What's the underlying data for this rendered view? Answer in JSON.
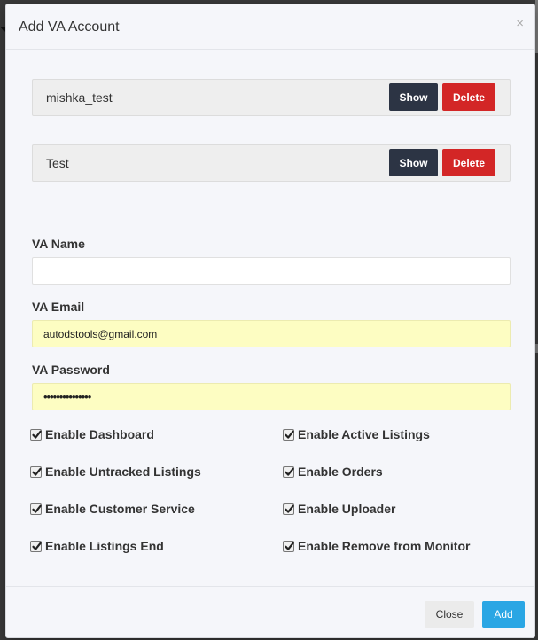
{
  "modal": {
    "title": "Add VA Account",
    "close_glyph": "×"
  },
  "accounts": [
    {
      "name": "mishka_test",
      "show_label": "Show",
      "delete_label": "Delete"
    },
    {
      "name": "Test",
      "show_label": "Show",
      "delete_label": "Delete"
    }
  ],
  "form": {
    "name_label": "VA Name",
    "name_value": "",
    "email_label": "VA Email",
    "email_value": "autodstools@gmail.com",
    "password_label": "VA Password",
    "password_masked": "•••••••••••••••"
  },
  "permissions": [
    {
      "label": "Enable Dashboard",
      "checked": true
    },
    {
      "label": "Enable Active Listings",
      "checked": true
    },
    {
      "label": "Enable Untracked Listings",
      "checked": true
    },
    {
      "label": "Enable Orders",
      "checked": true
    },
    {
      "label": "Enable Customer Service",
      "checked": true
    },
    {
      "label": "Enable Uploader",
      "checked": true
    },
    {
      "label": "Enable Listings End",
      "checked": true
    },
    {
      "label": "Enable Remove from Monitor",
      "checked": true
    }
  ],
  "footer": {
    "close_label": "Close",
    "add_label": "Add"
  },
  "colors": {
    "show_button": "#2c3444",
    "delete_button": "#d32626",
    "add_button": "#2aa6e4",
    "autofill_background": "#fdfdc2"
  },
  "icons": {
    "close": "close-icon",
    "checkbox": "checkmark-icon"
  }
}
